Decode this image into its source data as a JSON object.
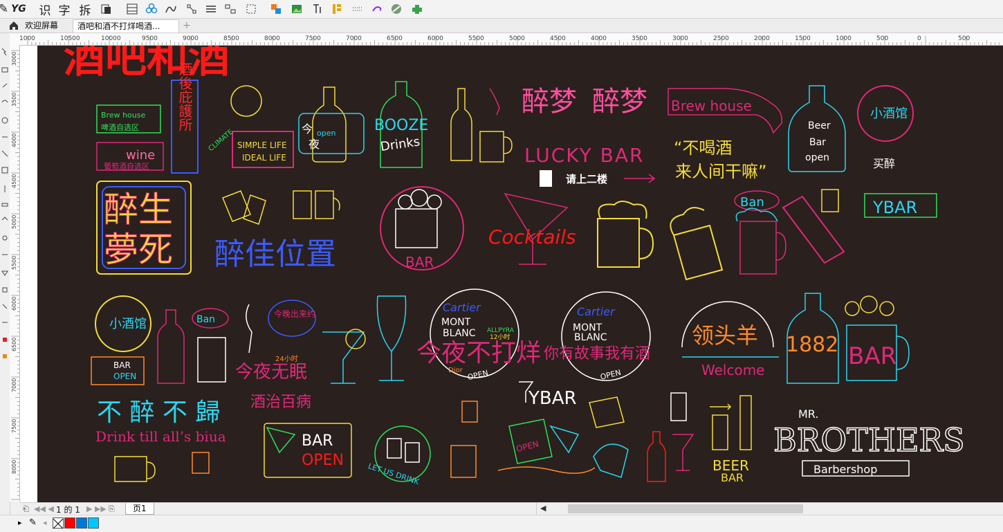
{
  "toolbar": {
    "icons": [
      "yg-logo",
      "recognize-icon",
      "text-icon",
      "split-icon",
      "page-icon",
      "grid-icon",
      "flower-icon",
      "curve-icon",
      "node-icon",
      "lines-icon",
      "align-icon",
      "select-icon",
      "color-shape-icon",
      "image-icon",
      "text-box-icon",
      "layers-icon",
      "dotted-icon",
      "magic-icon",
      "ball-icon",
      "plugin-icon"
    ],
    "yg_label": "YG",
    "recognize_label": "识",
    "char_label": "字",
    "split_label": "拆"
  },
  "tabs": {
    "home_label": "欢迎屏幕",
    "doc_label": "酒吧和酒不打烊喝酒...",
    "add_label": "+"
  },
  "ruler": {
    "top_ticks": [
      "1000",
      "10500",
      "10000",
      "9500",
      "9000",
      "8500",
      "8000",
      "7500",
      "7000",
      "6500",
      "6000",
      "5500",
      "5000",
      "4500",
      "4000",
      "3500",
      "3000",
      "2500",
      "2000",
      "1500",
      "1000",
      "500",
      "0",
      "500"
    ],
    "left_ticks": [
      "3000",
      "3500",
      "4000",
      "4500",
      "5000",
      "5500",
      "6000",
      "6500",
      "7000",
      "7500",
      "8000"
    ]
  },
  "artwork": {
    "title": "酒吧和酒",
    "brew_house": "Brew house",
    "beer_zone": "啤酒自选区",
    "wine": "wine",
    "wine_zone": "葡萄酒自选区",
    "vertical_sign": "酒後庇護所",
    "simple_life": "SIMPLE LIFE",
    "ideal_life": "IDEAL LIFE",
    "climate": "CLIMATE",
    "tonight_open_a": "今",
    "open_small": "open",
    "tonight_open_b": "夜",
    "booze": "BOOZE",
    "drinks": "Drinks",
    "zuimeng": "醉梦",
    "brew_house2": "Brew house",
    "lucky_bar": "LUCKY BAR",
    "go_upstairs": "请上二楼",
    "no_drink_1": "“不喝酒",
    "no_drink_2": "来人间干嘛”",
    "beer_label": "Beer",
    "bar_label": "Bar",
    "open_label": "open",
    "xiao_jiu_guan": "小酒馆",
    "mai_zui": "买醉",
    "zui_sheng": "醉生",
    "meng_si": "夢死",
    "zui_jia": "醉佳位置",
    "bar_round": "BAR",
    "cocktails": "Cocktails",
    "ban": "Ban",
    "ybar": "YBAR",
    "small_bar": "小酒馆",
    "ban2": "Ban",
    "tonight_out": "今晚出来约",
    "bar_open_small_1": "BAR",
    "bar_open_small_2": "OPEN",
    "tonight_no_sleep": "今夜无眠",
    "tag_24h": "24小时",
    "cartier": "Cartier",
    "mont": "MONT",
    "blanc": "BLANC",
    "allpyra": "ALLPYRA",
    "hours": "12小时",
    "tonight_no_close": "今夜不打烊",
    "dior": "Dior",
    "open_badge": "OPEN",
    "cartier2": "Cartier",
    "mont2": "MONT",
    "blanc2": "BLANC",
    "story": "你有故事我有酒",
    "open_badge2": "OPEN",
    "lead_sheep": "领头羊",
    "welcome": "Welcome",
    "year": "1882",
    "bar_big": "BAR",
    "no_drunk": "不 醉 不 歸",
    "cure": "酒治百病",
    "drink_till": "Drink till all’s biua",
    "bar_sign": "BAR",
    "open_sign": "OPEN",
    "let_us_drink": "LET US DRINK",
    "ybar2": "YBAR",
    "open_mug": "OPEN",
    "beer_sign": "BEER",
    "bar_small": "BAR",
    "mr": "MR.",
    "brothers": "BROTHERS",
    "barbershop": "Barbershop"
  },
  "pagebar": {
    "page_count": "1 的 1",
    "page_tab": "页1"
  },
  "palette": {
    "colors": [
      "#ffffff",
      "#ff0000",
      "#0078d7",
      "#00c8ff"
    ]
  },
  "colors": {
    "neon_red": "#ff1a1a",
    "neon_pink": "#e0287a",
    "neon_yellow": "#f4dc3c",
    "neon_cyan": "#2bd6f0",
    "neon_green": "#2ee05a",
    "neon_blue": "#3b5bff",
    "neon_purple": "#b24bff",
    "neon_orange": "#ff8a2b",
    "board_bg": "#2a201d"
  }
}
